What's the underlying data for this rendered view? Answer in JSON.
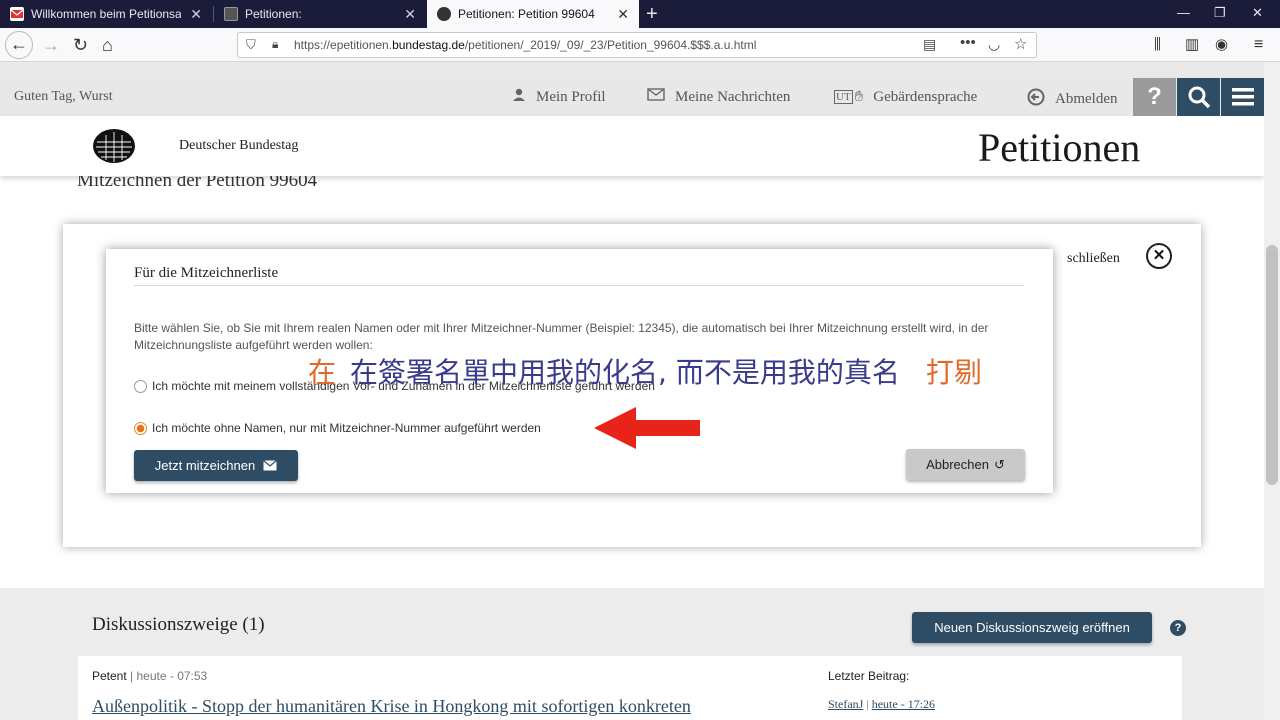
{
  "browser": {
    "tabs": [
      {
        "title": "Willkommen beim Petitionsausschuss",
        "active": false
      },
      {
        "title": "Petitionen:",
        "active": false
      },
      {
        "title": "Petitionen: Petition 99604",
        "active": true
      }
    ],
    "url_prefix": "https://epetitionen.",
    "url_domain": "bundestag.de",
    "url_path": "/petitionen/_2019/_09/_23/Petition_99604.$$$.a.u.html"
  },
  "site_nav": {
    "greeting": "Guten Tag, Wurst",
    "profile": "Mein Profil",
    "messages": "Meine Nachrichten",
    "sign_language": "Gebärdensprache",
    "logout": "Abmelden",
    "help_glyph": "?"
  },
  "header": {
    "institution": "Deutscher Bundestag",
    "section_title": "Petitionen",
    "page_heading": "Mitzeichnen der Petition 99604"
  },
  "modal": {
    "close_label": "schließen",
    "dialog_title": "Für die Mitzeichnerliste",
    "description": "Bitte wählen Sie, ob Sie mit Ihrem realen Namen oder mit Ihrer Mitzeichner-Nummer (Beispiel: 12345), die automatisch bei Ihrer Mitzeichnung erstellt wird, in der Mitzeichnungsliste aufgeführt werden wollen:",
    "option_fullname": "Ich möchte mit meinem vollständigen Vor- und Zunamen in der Mitzeichnerliste geführt werden",
    "option_number": "Ich möchte ohne Namen, nur mit Mitzeichner-Nummer aufgeführt werden",
    "selected_option": "option_number",
    "submit_label": "Jetzt mitzeichnen",
    "cancel_label": "Abbrechen"
  },
  "annotation": {
    "prefix": "在",
    "text": "在簽署名單中用我的化名, 而不是用我的真名",
    "suffix": "打剔"
  },
  "discussion": {
    "title": "Diskussionszweige (1)",
    "new_thread_label": "Neuen Diskussionszweig eröffnen",
    "thread": {
      "author": "Petent",
      "time": "heute - 07:53",
      "title": "Außenpolitik - Stopp der humanitären Krise in Hongkong mit sofortigen konkreten",
      "last_post_label": "Letzter Beitrag:",
      "last_user": "StefanJ",
      "last_time": "heute - 17:26"
    }
  },
  "colors": {
    "primary": "#2e4d65",
    "accent_orange": "#e3692a",
    "arrow_red": "#e8241a",
    "tabbar": "#1b1b3a"
  }
}
